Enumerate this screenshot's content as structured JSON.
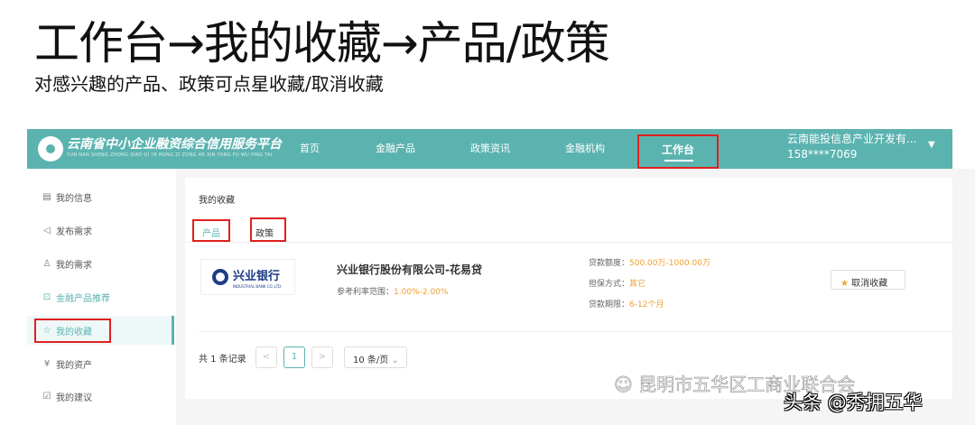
{
  "slide": {
    "title": "工作台→我的收藏→产品/政策",
    "subtitle": "对感兴趣的产品、政策可点星收藏/取消收藏"
  },
  "header": {
    "logo_title": "云南省中小企业融资综合信用服务平台",
    "logo_sub": "YUN NAN SHENG ZHONG XIAO QI YE RONG ZI ZONG HE XIN YONG FU WU PING TAI",
    "nav": [
      "首页",
      "金融产品",
      "政策资讯",
      "金融机构",
      "工作台"
    ],
    "user_name": "云南能投信息产业开发有...",
    "user_phone": "158****7069",
    "accent": "#5bb3b0"
  },
  "sidebar": {
    "items": [
      {
        "label": "我的信息",
        "icon": "id-card-icon"
      },
      {
        "label": "发布需求",
        "icon": "send-icon"
      },
      {
        "label": "我的需求",
        "icon": "user-icon"
      },
      {
        "label": "金融产品推荐",
        "icon": "recommend-icon"
      },
      {
        "label": "我的收藏",
        "icon": "star-icon"
      },
      {
        "label": "我的资产",
        "icon": "yuan-icon"
      },
      {
        "label": "我的建议",
        "icon": "edit-icon"
      }
    ]
  },
  "main": {
    "breadcrumb": "我的收藏",
    "tabs": [
      "产品",
      "政策"
    ],
    "product": {
      "bank_logo": "兴业银行",
      "bank_logo_en": "INDUSTRIAL BANK CO.,LTD",
      "name": "兴业银行股份有限公司-花易贷",
      "rate_label": "参考利率范围：",
      "rate": "1.00%-2.00%",
      "amount_label": "贷款额度：",
      "amount": "500.00万-1000.00万",
      "guarantee_label": "担保方式：",
      "guarantee": "其它",
      "term_label": "贷款期限：",
      "term": "6-12个月",
      "unfav": "取消收藏"
    },
    "pagination": {
      "total": "共 1 条记录",
      "prev": "<",
      "page": "1",
      "next": ">",
      "size": "10 条/页"
    }
  },
  "watermark": {
    "wechat": "昆明市五华区工商业联合会",
    "toutiao": "头条 @秀拥五华"
  }
}
